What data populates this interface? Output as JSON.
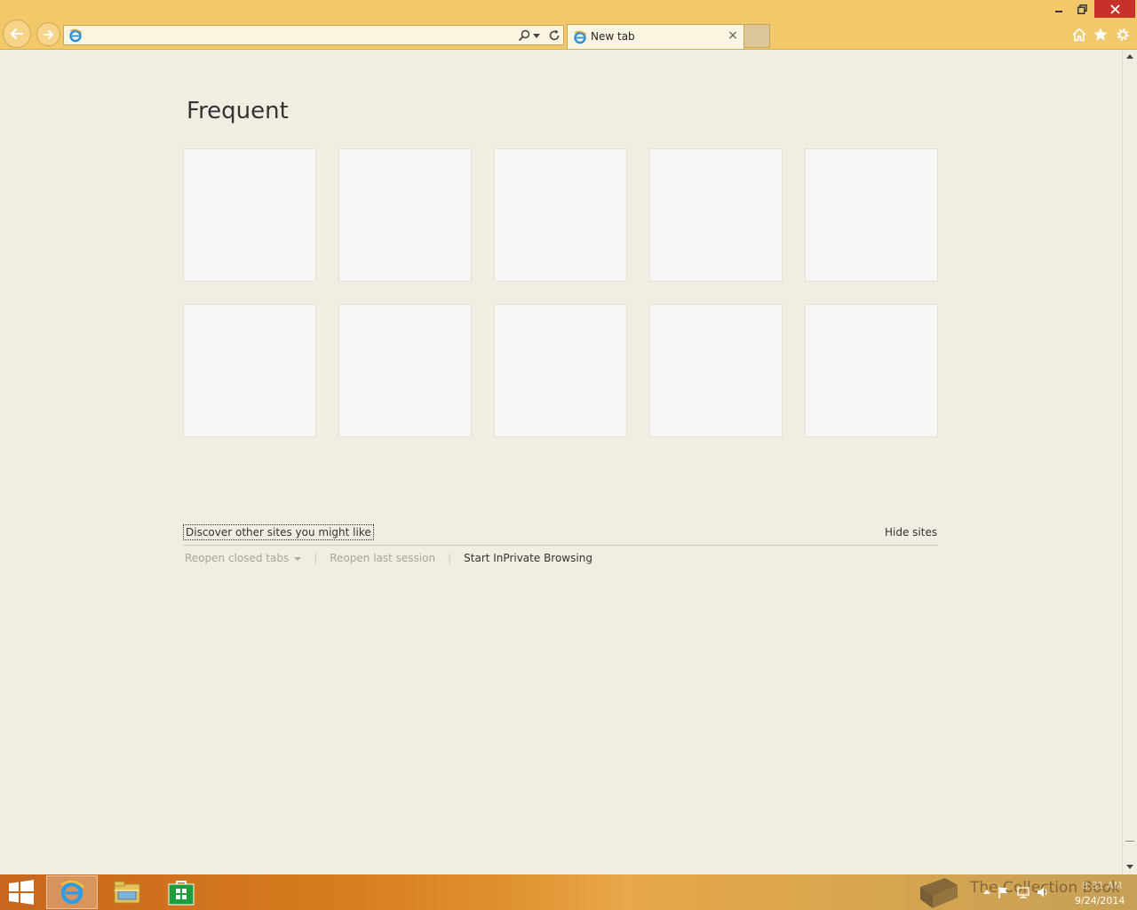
{
  "browser": {
    "address_value": "",
    "tab_title": "New tab",
    "tab_close_glyph": "×"
  },
  "window_controls": {
    "minimize": "minimize-icon",
    "restore": "restore-icon",
    "close": "close-icon"
  },
  "command_icons": [
    "home-icon",
    "favorites-icon",
    "tools-gear-icon"
  ],
  "content": {
    "section_title": "Frequent",
    "tiles_count_rows": 2,
    "tiles_per_row": 5,
    "discover_link": "Discover other sites you might like",
    "hide_sites": "Hide sites",
    "reopen_closed_tabs": "Reopen closed tabs",
    "reopen_last_session": "Reopen last session",
    "start_inprivate": "Start InPrivate Browsing",
    "separator": "|"
  },
  "taskbar": {
    "apps": [
      "internet-explorer",
      "file-explorer",
      "store"
    ],
    "watermark": "The Collection Book",
    "clock_time": "8:31 AM",
    "clock_date": "9/24/2014"
  },
  "colors": {
    "chrome": "#f2c96a",
    "content_bg": "#f2ede3",
    "tile_bg": "#f7f6f4",
    "close_red": "#c7312a",
    "taskbar_orange": "#d77c1f"
  }
}
